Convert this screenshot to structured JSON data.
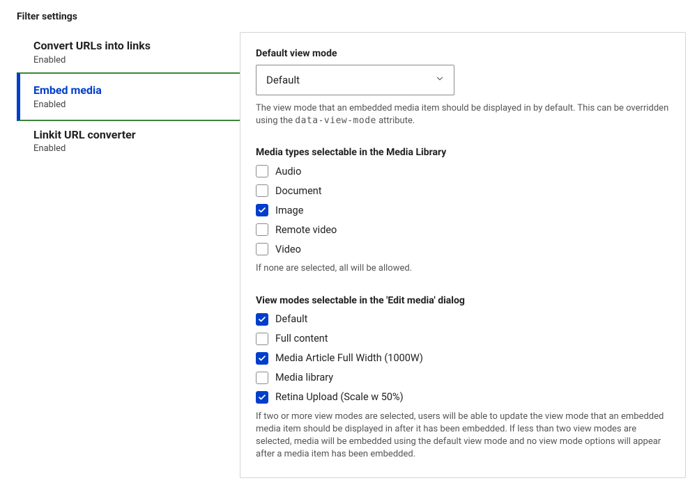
{
  "sectionTitle": "Filter settings",
  "tabs": [
    {
      "title": "Convert URLs into links",
      "sub": "Enabled",
      "active": false
    },
    {
      "title": "Embed media",
      "sub": "Enabled",
      "active": true
    },
    {
      "title": "Linkit URL converter",
      "sub": "Enabled",
      "active": false
    }
  ],
  "defaultViewMode": {
    "label": "Default view mode",
    "value": "Default",
    "helpPrefix": "The view mode that an embedded media item should be displayed in by default. This can be overridden using the ",
    "helpCode": "data-view-mode",
    "helpSuffix": " attribute."
  },
  "mediaTypes": {
    "label": "Media types selectable in the Media Library",
    "items": [
      {
        "label": "Audio",
        "checked": false
      },
      {
        "label": "Document",
        "checked": false
      },
      {
        "label": "Image",
        "checked": true
      },
      {
        "label": "Remote video",
        "checked": false
      },
      {
        "label": "Video",
        "checked": false
      }
    ],
    "help": "If none are selected, all will be allowed."
  },
  "viewModes": {
    "label": "View modes selectable in the 'Edit media' dialog",
    "items": [
      {
        "label": "Default",
        "checked": true
      },
      {
        "label": "Full content",
        "checked": false
      },
      {
        "label": "Media Article Full Width (1000W)",
        "checked": true
      },
      {
        "label": "Media library",
        "checked": false
      },
      {
        "label": "Retina Upload (Scale w 50%)",
        "checked": true
      }
    ],
    "help": "If two or more view modes are selected, users will be able to update the view mode that an embedded media item should be displayed in after it has been embedded. If less than two view modes are selected, media will be embedded using the default view mode and no view mode options will appear after a media item has been embedded."
  }
}
